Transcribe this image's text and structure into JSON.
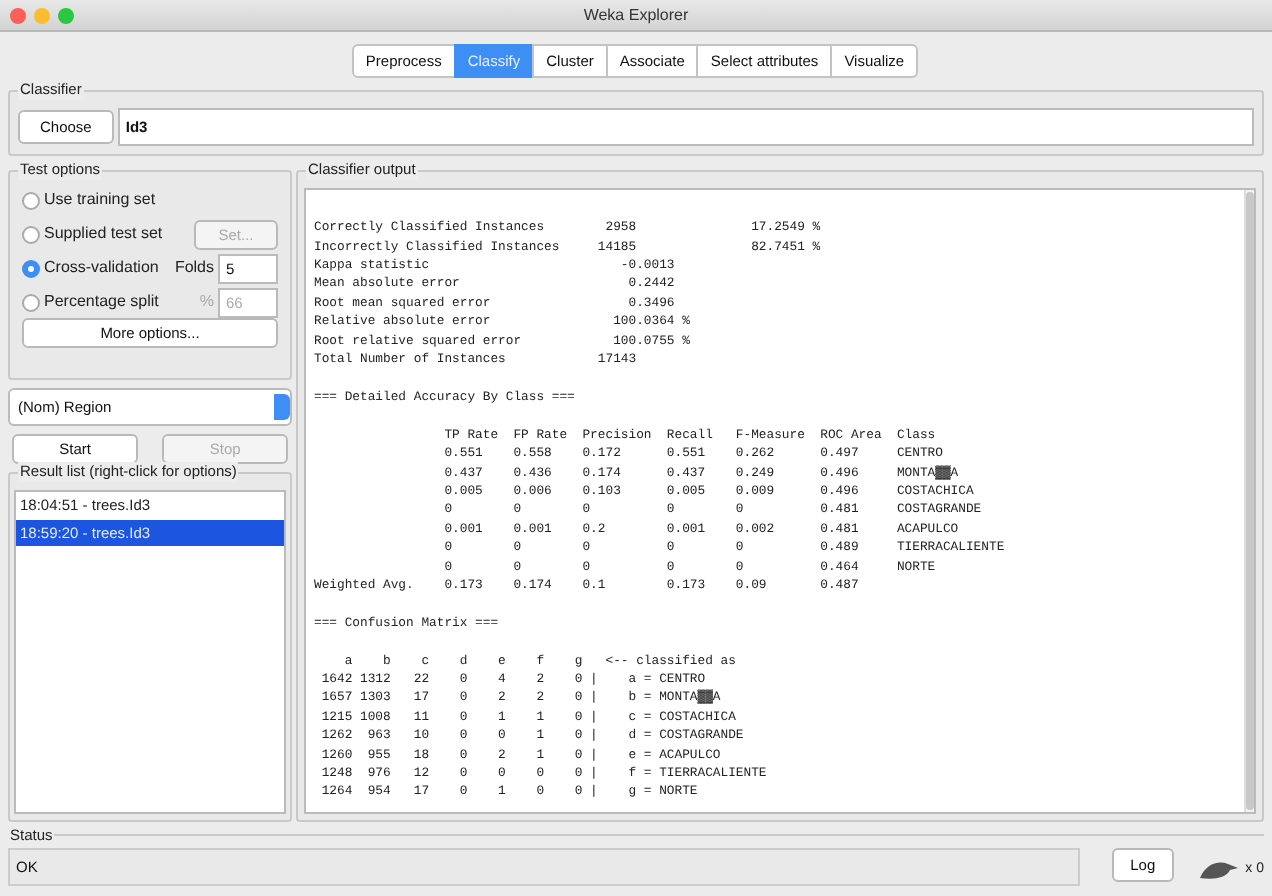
{
  "window": {
    "title": "Weka Explorer"
  },
  "tabs": [
    {
      "label": "Preprocess",
      "selected": false
    },
    {
      "label": "Classify",
      "selected": true
    },
    {
      "label": "Cluster",
      "selected": false
    },
    {
      "label": "Associate",
      "selected": false
    },
    {
      "label": "Select attributes",
      "selected": false
    },
    {
      "label": "Visualize",
      "selected": false
    }
  ],
  "classifier": {
    "title": "Classifier",
    "button": "Choose",
    "value": "Id3"
  },
  "test_options": {
    "title": "Test options",
    "options": [
      {
        "label": "Use training set",
        "selected": false
      },
      {
        "label": "Supplied test set",
        "selected": false,
        "button": {
          "label": "Set...",
          "disabled": true
        }
      },
      {
        "label": "Cross-validation",
        "selected": true,
        "field": {
          "label": "Folds",
          "value": "5",
          "disabled": false
        }
      },
      {
        "label": "Percentage split",
        "selected": false,
        "field": {
          "label": "%",
          "value": "66",
          "disabled": true
        }
      }
    ],
    "more_button": "More options..."
  },
  "class_dropdown": "(Nom) Region",
  "start_button": {
    "label": "Start",
    "disabled": false
  },
  "stop_button": {
    "label": "Stop",
    "disabled": true
  },
  "result_list": {
    "title": "Result list (right-click for options)",
    "items": [
      {
        "label": "18:04:51 - trees.Id3",
        "selected": false
      },
      {
        "label": "18:59:20 - trees.Id3",
        "selected": true
      }
    ]
  },
  "output": {
    "title": "Classifier output",
    "summary": [
      "Correctly Classified Instances        2958               17.2549 %",
      "Incorrectly Classified Instances     14185               82.7451 %",
      "Kappa statistic                         -0.0013",
      "Mean absolute error                      0.2442",
      "Root mean squared error                  0.3496",
      "Relative absolute error                100.0364 %",
      "Root relative squared error            100.0755 %",
      "Total Number of Instances            17143"
    ],
    "sections": [
      {
        "heading": "=== Detailed Accuracy By Class ===",
        "lines": [
          "                 TP Rate  FP Rate  Precision  Recall   F-Measure  ROC Area  Class",
          "                 0.551    0.558    0.172      0.551    0.262      0.497     CENTRO",
          "                 0.437    0.436    0.174      0.437    0.249      0.496     MONTA▓▓A",
          "                 0.005    0.006    0.103      0.005    0.009      0.496     COSTACHICA",
          "                 0        0        0          0        0          0.481     COSTAGRANDE",
          "                 0.001    0.001    0.2        0.001    0.002      0.481     ACAPULCO",
          "                 0        0        0          0        0          0.489     TIERRACALIENTE",
          "                 0        0        0          0        0          0.464     NORTE",
          "Weighted Avg.    0.173    0.174    0.1        0.173    0.09       0.487"
        ]
      },
      {
        "heading": "=== Confusion Matrix ===",
        "lines": [
          "    a    b    c    d    e    f    g   <-- classified as",
          " 1642 1312   22    0    4    2    0 |    a = CENTRO",
          " 1657 1303   17    0    2    2    0 |    b = MONTA▓▓A",
          " 1215 1008   11    0    1    1    0 |    c = COSTACHICA",
          " 1262  963   10    0    0    1    0 |    d = COSTAGRANDE",
          " 1260  955   18    0    2    1    0 |    e = ACAPULCO",
          " 1248  976   12    0    0    0    0 |    f = TIERRACALIENTE",
          " 1264  954   17    0    1    0    0 |    g = NORTE"
        ]
      }
    ]
  },
  "status": {
    "title": "Status",
    "text": "OK",
    "log_button": "Log",
    "count": "x 0"
  }
}
